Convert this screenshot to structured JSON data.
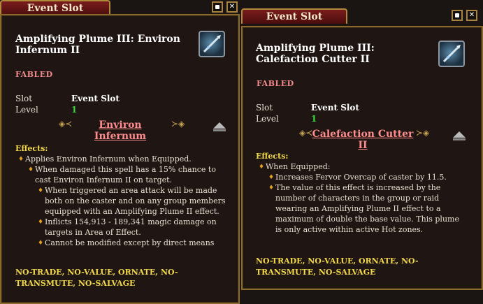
{
  "left": {
    "tab_title": "Event Slot",
    "name": "Amplifying Plume III: Environ Infernum II",
    "tier": "FABLED",
    "slot_label": "Slot",
    "slot_value": "Event Slot",
    "level_label": "Level",
    "level_value": "1",
    "spell": "Environ Infernum",
    "effects_header": "Effects:",
    "effects": [
      "Applies Environ Infernum when Equipped.",
      "When damaged this spell has a 15% chance to cast Environ Infernum II on target.",
      "When triggered an area attack will be made both on the caster and on any group members equipped with an Amplifying Plume II effect.",
      "Inflicts 154,913 - 189,341 magic damage on targets in Area of Effect.",
      "Cannot be modified except by direct means"
    ],
    "flags": "NO-TRADE, NO-VALUE, ORNATE, NO-TRANSMUTE, NO-SALVAGE"
  },
  "right": {
    "tab_title": "Event Slot",
    "name": "Amplifying Plume III: Calefaction Cutter II",
    "tier": "FABLED",
    "slot_label": "Slot",
    "slot_value": "Event Slot",
    "level_label": "Level",
    "level_value": "1",
    "spell": "Calefaction Cutter II",
    "effects_header": "Effects:",
    "effects": [
      "When Equipped:",
      "Increases Fervor Overcap of caster by 11.5.",
      "The value of this effect is increased by the number of characters in the group or raid wearing an Amplifying Plume II effect to a maximum of double the base value. This plume is only active within active Hot zones."
    ],
    "flags": "NO-TRADE, NO-VALUE, ORNATE, NO-TRANSMUTE, NO-SALVAGE"
  },
  "buttons": {
    "pin": "■",
    "close": "✕"
  },
  "colors": {
    "fabled": "#f08a8a",
    "level": "#3bd63b",
    "effects": "#f2d84a",
    "spell_link": "#ff8c8c"
  }
}
